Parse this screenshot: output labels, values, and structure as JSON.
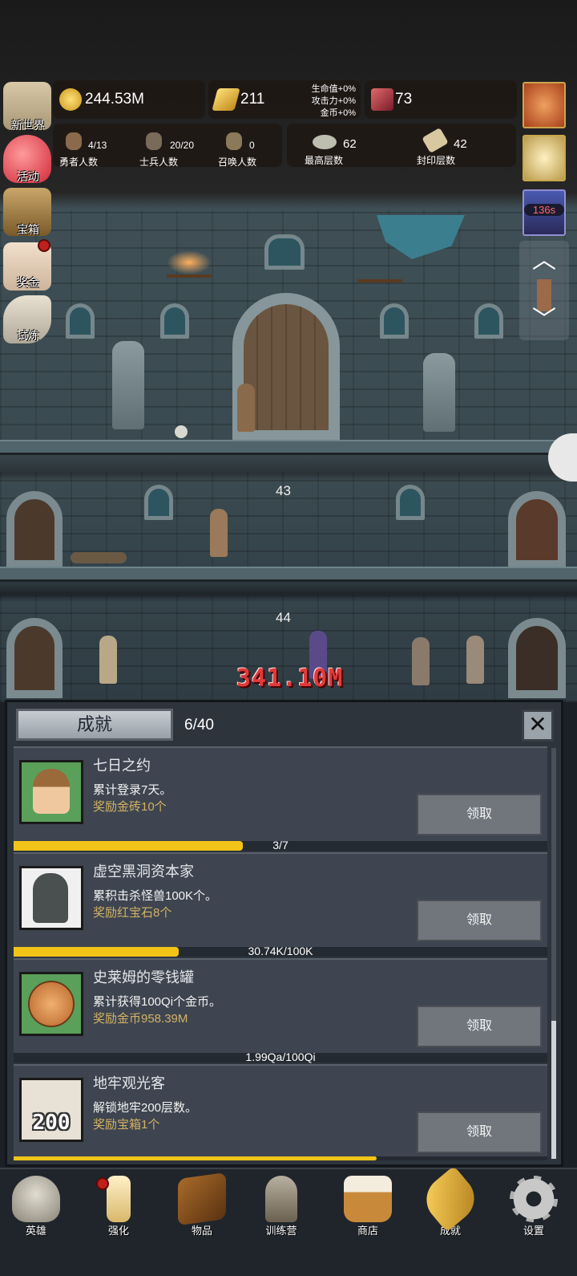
{
  "resources": {
    "gold": "244.53M",
    "gold_bars": "211",
    "rubies": "73",
    "bonuses": [
      "生命值+0%",
      "攻击力+0%",
      "金币+0%"
    ]
  },
  "counts": [
    {
      "value": "4/13",
      "label": "勇者人数"
    },
    {
      "value": "20/20",
      "label": "士兵人数"
    },
    {
      "value": "0",
      "label": "召唤人数"
    },
    {
      "value": "62",
      "label": "最高层数"
    },
    {
      "value": "42",
      "label": "封印层数"
    }
  ],
  "side_menu": [
    "新世界",
    "活动",
    "宝箱",
    "奖金",
    "试炼"
  ],
  "timer": "136s",
  "floors": [
    "43",
    "44"
  ],
  "damage": "341.10M",
  "achievements": {
    "title": "成就",
    "count": "6/40",
    "items": [
      {
        "title": "七日之约",
        "desc": "累计登录7天。",
        "reward": "奖励金砖10个",
        "button": "领取",
        "progress_text": "3/7",
        "progress": 0.43
      },
      {
        "title": "虚空黑洞资本家",
        "desc": "累积击杀怪兽100K个。",
        "reward": "奖励红宝石8个",
        "button": "领取",
        "progress_text": "30.74K/100K",
        "progress": 0.31
      },
      {
        "title": "史莱姆的零钱罐",
        "desc": "累计获得100Qi个金币。",
        "reward": "奖励金币958.39M",
        "button": "领取",
        "progress_text": "1.99Qa/100Qi",
        "progress": 0.0
      },
      {
        "title": "地牢观光客",
        "desc": "解锁地牢200层数。",
        "reward": "奖励宝箱1个",
        "button": "领取",
        "progress_text": "",
        "progress": 0.68
      }
    ],
    "badge_text": "200"
  },
  "nav": [
    "英雄",
    "强化",
    "物品",
    "训练营",
    "商店",
    "成就",
    "设置"
  ],
  "colors": {
    "progress": "#f2c418",
    "reward": "#d4b264",
    "damage": "#e03a3a"
  }
}
